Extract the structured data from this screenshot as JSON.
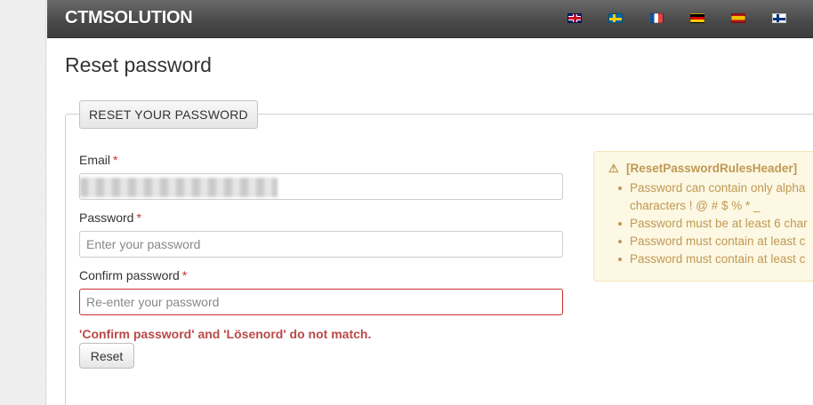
{
  "navbar": {
    "brand": "CTMSOLUTION",
    "languages": [
      {
        "code": "en",
        "icon": "uk-flag-icon"
      },
      {
        "code": "sv",
        "icon": "sweden-flag-icon"
      },
      {
        "code": "fr",
        "icon": "france-flag-icon"
      },
      {
        "code": "de",
        "icon": "germany-flag-icon"
      },
      {
        "code": "es",
        "icon": "spain-flag-icon"
      },
      {
        "code": "fi",
        "icon": "finland-flag-icon"
      }
    ]
  },
  "page": {
    "title": "Reset password"
  },
  "form": {
    "legend": "RESET YOUR PASSWORD",
    "email": {
      "label": "Email",
      "required_mark": "*",
      "value": "",
      "placeholder": ""
    },
    "password": {
      "label": "Password",
      "required_mark": "*",
      "value": "",
      "placeholder": "Enter your password"
    },
    "confirm_password": {
      "label": "Confirm password",
      "required_mark": "*",
      "value": "",
      "placeholder": "Re-enter your password"
    },
    "error_message": "'Confirm password' and 'Lösenord' do not match.",
    "submit_label": "Reset"
  },
  "rules": {
    "header": "[ResetPasswordRulesHeader]",
    "items": [
      {
        "line1": "Password can contain only alpha",
        "line2": "characters ! @ # $ % * _"
      },
      {
        "line1": "Password must be at least 6 char"
      },
      {
        "line1": "Password must contain at least c"
      },
      {
        "line1": "Password must contain at least c"
      }
    ]
  },
  "colors": {
    "navbar": "#4a4a4a",
    "error": "#b94a48",
    "required": "#c9302c",
    "alert_bg": "#fcf8e3",
    "alert_text": "#c09853"
  }
}
